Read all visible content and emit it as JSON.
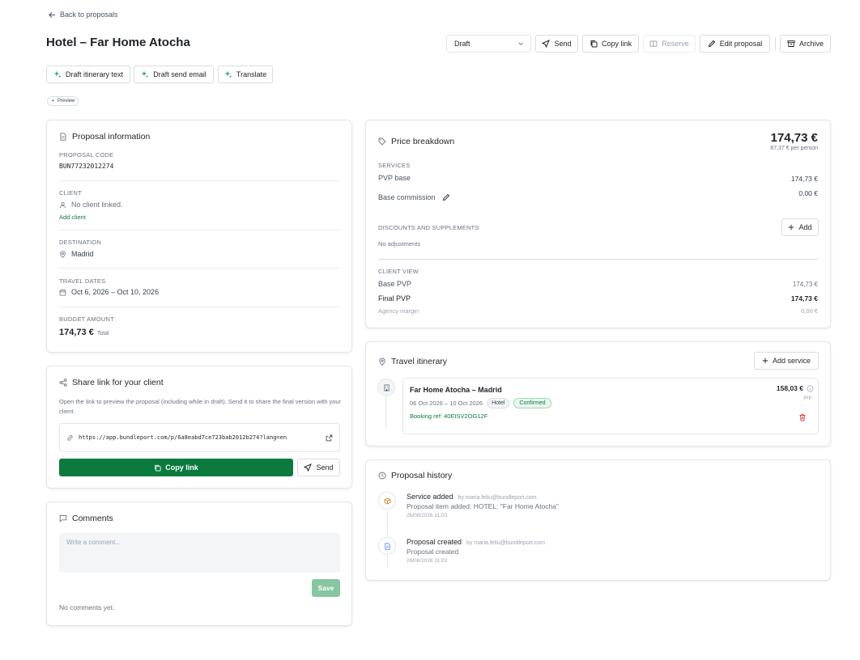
{
  "nav": {
    "back_label": "Back to proposals"
  },
  "header": {
    "title": "Hotel – Far Home Atocha",
    "status_value": "Draft",
    "send_label": "Send",
    "copy_link_label": "Copy link",
    "reserve_label": "Reserve",
    "edit_label": "Edit proposal",
    "archive_label": "Archive"
  },
  "ai_actions": {
    "draft_itinerary": "Draft itinerary text",
    "draft_email": "Draft send email",
    "translate": "Translate",
    "preview_badge": "Preview"
  },
  "proposal_info": {
    "title": "Proposal information",
    "code_label": "PROPOSAL CODE",
    "code_value": "BUN77232012274",
    "client_label": "CLIENT",
    "client_value": "No client linked.",
    "add_client": "Add client",
    "destination_label": "DESTINATION",
    "destination_value": "Madrid",
    "dates_label": "TRAVEL DATES",
    "dates_value": "Oct 6, 2026 – Oct 10, 2026",
    "budget_label": "BUDGET AMOUNT",
    "budget_value": "174,73 €",
    "budget_suffix": "Total"
  },
  "share": {
    "title": "Share link for your client",
    "description": "Open the link to preview the proposal (including while in draft). Send it to share the final version with your client.",
    "url": "https://app.bundleport.com/p/6a8eabd7ce723bab2012b274?lang=en",
    "copy_label": "Copy link",
    "send_label": "Send"
  },
  "comments": {
    "title": "Comments",
    "placeholder": "Write a comment...",
    "save_label": "Save",
    "empty": "No comments yet."
  },
  "price": {
    "title": "Price breakdown",
    "total": "174,73 €",
    "per_person": "87,37 € per person",
    "services_label": "SERVICES",
    "pvp_base_label": "PVP base",
    "pvp_base_value": "174,73 €",
    "commission_label": "Base commission",
    "commission_value": "0,00 €",
    "discounts_label": "DISCOUNTS AND SUPPLEMENTS",
    "add_label": "Add",
    "no_adjustments": "No adjustments",
    "client_view_label": "CLIENT VIEW",
    "base_pvp_label": "Base PVP",
    "base_pvp_value": "174,73 €",
    "final_pvp_label": "Final PVP",
    "final_pvp_value": "174,73 €",
    "margin_label": "Agency margin",
    "margin_value": "0,00 €"
  },
  "itinerary": {
    "title": "Travel itinerary",
    "add_service": "Add service",
    "item": {
      "name": "Far Home Atocha – Madrid",
      "dates": "06 Oct 2026 – 10 Oct 2026",
      "type_badge": "Hotel",
      "status_badge": "Confirmed",
      "booking_ref": "Booking ref: 40EISV2OG12F",
      "price": "158,03 €",
      "price_unit": "pvp"
    }
  },
  "history": {
    "title": "Proposal history",
    "events": [
      {
        "title": "Service added",
        "by": "by maria.feliu@bundleport.com",
        "desc": "Proposal item added: HOTEL: \"Far Home Atocha\"",
        "time": "26/08/2026 11:03"
      },
      {
        "title": "Proposal created",
        "by": "by maria.feliu@bundleport.com",
        "desc": "Proposal created",
        "time": "26/08/2026 11:03"
      }
    ]
  },
  "colors": {
    "primary": "#0b7a3e",
    "save_disabled": "#86c6a0",
    "accent_green": "#1f9d6b",
    "danger": "#e53e3e"
  }
}
